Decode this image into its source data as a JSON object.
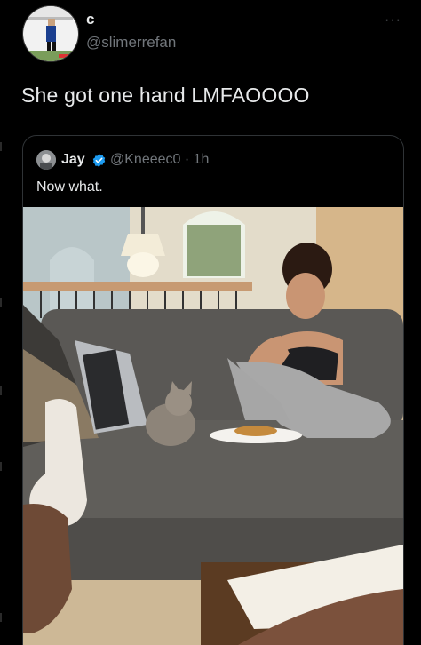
{
  "tweet": {
    "display_name": "c",
    "handle": "@slimerrefan",
    "more_glyph": "···",
    "text": "She got one hand LMFAOOOO"
  },
  "quoted_tweet": {
    "display_name": "Jay",
    "handle_time": "@Kneeec0 · 1h",
    "text": "Now what."
  },
  "icons": {
    "verified": "verified-badge-icon",
    "more": "more-icon"
  },
  "colors": {
    "background": "#000000",
    "text": "#e7e9ea",
    "secondary": "#71767b",
    "verified": "#1d9bf0",
    "border": "#2f3336"
  }
}
